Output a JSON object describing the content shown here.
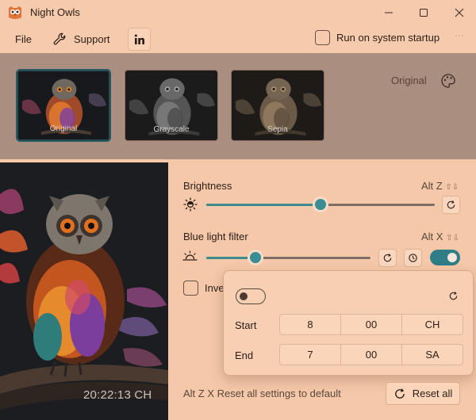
{
  "window": {
    "title": "Night Owls"
  },
  "menu": {
    "file": "File",
    "support": "Support",
    "startup_label": "Run on system startup",
    "startup_checked": false
  },
  "presets": {
    "items": [
      {
        "label": "Original",
        "selected": true
      },
      {
        "label": "Grayscale",
        "selected": false
      },
      {
        "label": "Sepia",
        "selected": false
      }
    ],
    "current": "Original"
  },
  "image": {
    "clock": "20:22:13 CH"
  },
  "brightness": {
    "label": "Brightness",
    "hotkey": "Alt Z",
    "value": 0.5
  },
  "blue_light": {
    "label": "Blue light filter",
    "hotkey": "Alt X",
    "value": 0.3,
    "enabled": true
  },
  "invert": {
    "label": "Inve",
    "checked": false
  },
  "schedule": {
    "enabled": false,
    "start": {
      "label": "Start",
      "hour": "8",
      "minute": "00",
      "period": "CH"
    },
    "end": {
      "label": "End",
      "hour": "7",
      "minute": "00",
      "period": "SA"
    }
  },
  "footer": {
    "hotkey_text": "Alt Z X  Reset all settings to default",
    "reset_all": "Reset all"
  },
  "colors": {
    "accent": "#3a8d93",
    "background": "#f5c8a9",
    "strip": "#aa8e80"
  }
}
